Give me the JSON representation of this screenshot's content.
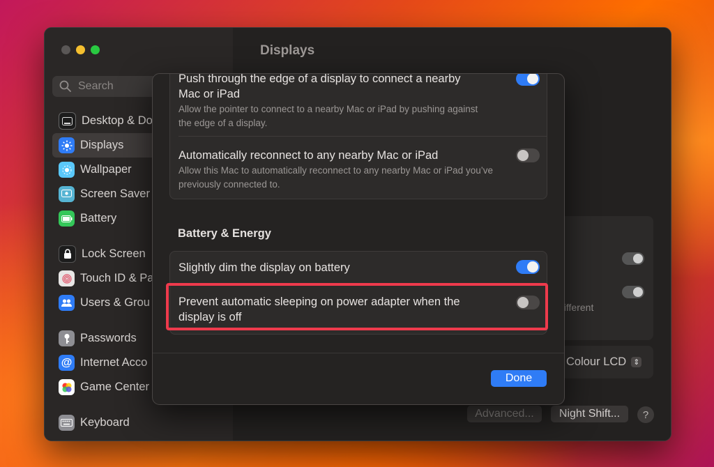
{
  "window": {
    "title": "Displays"
  },
  "search": {
    "placeholder": "Search"
  },
  "sidebar": {
    "items": [
      {
        "label": "Desktop & Do",
        "icon": "desktop-dock-icon",
        "color": "#1c1c1c"
      },
      {
        "label": "Displays",
        "icon": "displays-icon",
        "color": "#2f7cf6"
      },
      {
        "label": "Wallpaper",
        "icon": "wallpaper-icon",
        "color": "#5ac8fa"
      },
      {
        "label": "Screen Saver",
        "icon": "screen-saver-icon",
        "color": "#56b4d3"
      },
      {
        "label": "Battery",
        "icon": "battery-icon",
        "color": "#34c759"
      },
      {
        "label": "Lock Screen",
        "icon": "lock-icon",
        "color": "#1c1c1c"
      },
      {
        "label": "Touch ID & Pa",
        "icon": "fingerprint-icon",
        "color": "#e8e6e5"
      },
      {
        "label": "Users & Grou",
        "icon": "users-icon",
        "color": "#2f7cf6"
      },
      {
        "label": "Passwords",
        "icon": "key-icon",
        "color": "#8e8e93"
      },
      {
        "label": "Internet Acco",
        "icon": "at-icon",
        "color": "#2f7cf6"
      },
      {
        "label": "Game Center",
        "icon": "game-center-icon",
        "color": "#ffffff"
      },
      {
        "label": "Keyboard",
        "icon": "keyboard-icon",
        "color": "#8e8e93"
      }
    ]
  },
  "background_panel": {
    "different_text": "different",
    "colour_lcd": "Colour LCD",
    "advanced_label": "Advanced...",
    "night_shift_label": "Night Shift...",
    "help_label": "?"
  },
  "modal": {
    "rows_top": [
      {
        "title": "Push through the edge of a display to connect a nearby Mac or iPad",
        "subtitle": "Allow the pointer to connect to a nearby Mac or iPad by pushing against the edge of a display.",
        "enabled": true
      },
      {
        "title": "Automatically reconnect to any nearby Mac or iPad",
        "subtitle": "Allow this Mac to automatically reconnect to any nearby Mac or iPad you’ve previously connected to.",
        "enabled": false
      }
    ],
    "section_title": "Battery & Energy",
    "rows_energy": [
      {
        "title": "Slightly dim the display on battery",
        "enabled": true
      },
      {
        "title": "Prevent automatic sleeping on power adapter when the display is off",
        "enabled": false
      }
    ],
    "done_label": "Done"
  },
  "colors": {
    "accent": "#2f7cf6",
    "highlight": "#ee3a4c"
  }
}
